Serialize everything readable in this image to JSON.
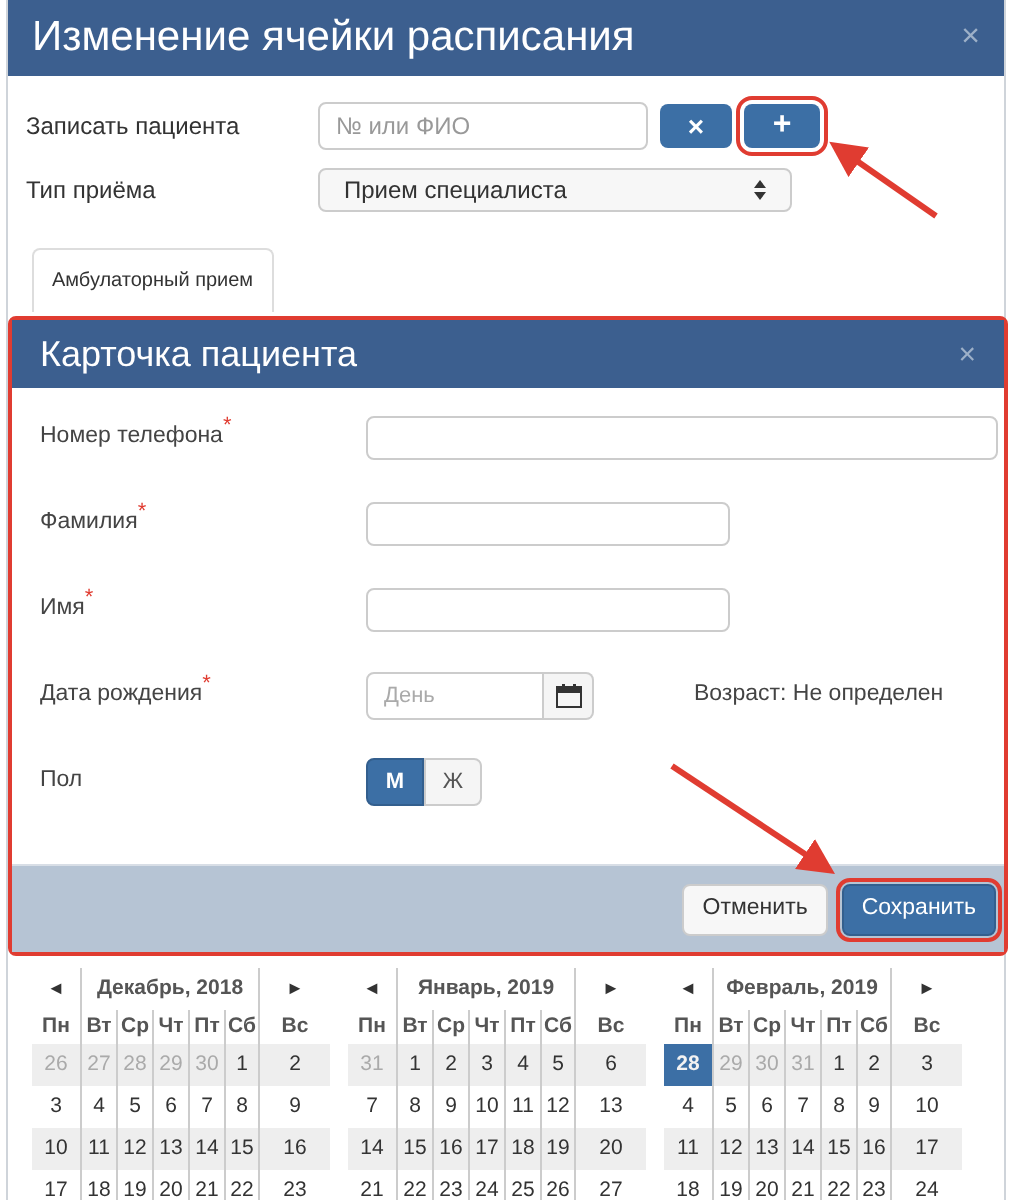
{
  "window": {
    "title": "Изменение ячейки расписания",
    "close": "×"
  },
  "form": [
    {
      "label": "Записать пациента",
      "kind": "search",
      "placeholder": "№ или ФИО",
      "clear": "×",
      "add": "+",
      "add_highlighted": true
    },
    {
      "label": "Тип приёма",
      "kind": "select",
      "value": "Прием специалиста"
    }
  ],
  "tabs": [
    {
      "label": "Амбулаторный прием",
      "selected": true
    }
  ],
  "patient_card": {
    "title": "Карточка пациента",
    "close": "×",
    "highlighted": true,
    "fields": [
      {
        "label": "Номер телефона",
        "required_mark": "*",
        "kind": "wide"
      },
      {
        "label": "Фамилия",
        "required_mark": "*",
        "kind": "text"
      },
      {
        "label": "Имя",
        "required_mark": "*",
        "kind": "text"
      },
      {
        "label": "Дата рождения",
        "required_mark": "*",
        "kind": "date",
        "placeholder": "День",
        "note": "Возраст: Не определен"
      },
      {
        "label": "Пол",
        "kind": "toggle",
        "options": [
          {
            "label": "М",
            "selected": true
          },
          {
            "label": "Ж",
            "selected": false
          }
        ]
      }
    ],
    "buttons": [
      {
        "label": "Отменить",
        "kind": "default",
        "highlighted": false
      },
      {
        "label": "Сохранить",
        "kind": "primary",
        "highlighted": true
      }
    ]
  },
  "calendars": [
    {
      "title": "Декабрь, 2018",
      "prev": "◄",
      "next": "►",
      "weekdays": [
        "Пн",
        "Вт",
        "Ср",
        "Чт",
        "Пт",
        "Сб",
        "Вс"
      ],
      "weeks": [
        [
          {
            "t": "26",
            "other": true,
            "selected": false
          },
          {
            "t": "27",
            "other": true,
            "selected": false
          },
          {
            "t": "28",
            "other": true,
            "selected": false
          },
          {
            "t": "29",
            "other": true,
            "selected": false
          },
          {
            "t": "30",
            "other": true,
            "selected": false
          },
          {
            "t": "1",
            "other": false,
            "selected": false
          },
          {
            "t": "2",
            "other": false,
            "selected": false
          }
        ],
        [
          {
            "t": "3",
            "other": false,
            "selected": false
          },
          {
            "t": "4",
            "other": false,
            "selected": false
          },
          {
            "t": "5",
            "other": false,
            "selected": false
          },
          {
            "t": "6",
            "other": false,
            "selected": false
          },
          {
            "t": "7",
            "other": false,
            "selected": false
          },
          {
            "t": "8",
            "other": false,
            "selected": false
          },
          {
            "t": "9",
            "other": false,
            "selected": false
          }
        ],
        [
          {
            "t": "10",
            "other": false,
            "selected": false
          },
          {
            "t": "11",
            "other": false,
            "selected": false
          },
          {
            "t": "12",
            "other": false,
            "selected": false
          },
          {
            "t": "13",
            "other": false,
            "selected": false
          },
          {
            "t": "14",
            "other": false,
            "selected": false
          },
          {
            "t": "15",
            "other": false,
            "selected": false
          },
          {
            "t": "16",
            "other": false,
            "selected": false
          }
        ],
        [
          {
            "t": "17",
            "other": false,
            "selected": false
          },
          {
            "t": "18",
            "other": false,
            "selected": false
          },
          {
            "t": "19",
            "other": false,
            "selected": false
          },
          {
            "t": "20",
            "other": false,
            "selected": false
          },
          {
            "t": "21",
            "other": false,
            "selected": false
          },
          {
            "t": "22",
            "other": false,
            "selected": false
          },
          {
            "t": "23",
            "other": false,
            "selected": false
          }
        ]
      ]
    },
    {
      "title": "Январь, 2019",
      "prev": "◄",
      "next": "►",
      "weekdays": [
        "Пн",
        "Вт",
        "Ср",
        "Чт",
        "Пт",
        "Сб",
        "Вс"
      ],
      "weeks": [
        [
          {
            "t": "31",
            "other": true,
            "selected": false
          },
          {
            "t": "1",
            "other": false,
            "selected": false
          },
          {
            "t": "2",
            "other": false,
            "selected": false
          },
          {
            "t": "3",
            "other": false,
            "selected": false
          },
          {
            "t": "4",
            "other": false,
            "selected": false
          },
          {
            "t": "5",
            "other": false,
            "selected": false
          },
          {
            "t": "6",
            "other": false,
            "selected": false
          }
        ],
        [
          {
            "t": "7",
            "other": false,
            "selected": false
          },
          {
            "t": "8",
            "other": false,
            "selected": false
          },
          {
            "t": "9",
            "other": false,
            "selected": false
          },
          {
            "t": "10",
            "other": false,
            "selected": false
          },
          {
            "t": "11",
            "other": false,
            "selected": false
          },
          {
            "t": "12",
            "other": false,
            "selected": false
          },
          {
            "t": "13",
            "other": false,
            "selected": false
          }
        ],
        [
          {
            "t": "14",
            "other": false,
            "selected": false
          },
          {
            "t": "15",
            "other": false,
            "selected": false
          },
          {
            "t": "16",
            "other": false,
            "selected": false
          },
          {
            "t": "17",
            "other": false,
            "selected": false
          },
          {
            "t": "18",
            "other": false,
            "selected": false
          },
          {
            "t": "19",
            "other": false,
            "selected": false
          },
          {
            "t": "20",
            "other": false,
            "selected": false
          }
        ],
        [
          {
            "t": "21",
            "other": false,
            "selected": false
          },
          {
            "t": "22",
            "other": false,
            "selected": false
          },
          {
            "t": "23",
            "other": false,
            "selected": false
          },
          {
            "t": "24",
            "other": false,
            "selected": false
          },
          {
            "t": "25",
            "other": false,
            "selected": false
          },
          {
            "t": "26",
            "other": false,
            "selected": false
          },
          {
            "t": "27",
            "other": false,
            "selected": false
          }
        ]
      ]
    },
    {
      "title": "Февраль, 2019",
      "prev": "◄",
      "next": "►",
      "weekdays": [
        "Пн",
        "Вт",
        "Ср",
        "Чт",
        "Пт",
        "Сб",
        "Вс"
      ],
      "weeks": [
        [
          {
            "t": "28",
            "other": true,
            "selected": true
          },
          {
            "t": "29",
            "other": true,
            "selected": false
          },
          {
            "t": "30",
            "other": true,
            "selected": false
          },
          {
            "t": "31",
            "other": true,
            "selected": false
          },
          {
            "t": "1",
            "other": false,
            "selected": false
          },
          {
            "t": "2",
            "other": false,
            "selected": false
          },
          {
            "t": "3",
            "other": false,
            "selected": false
          }
        ],
        [
          {
            "t": "4",
            "other": false,
            "selected": false
          },
          {
            "t": "5",
            "other": false,
            "selected": false
          },
          {
            "t": "6",
            "other": false,
            "selected": false
          },
          {
            "t": "7",
            "other": false,
            "selected": false
          },
          {
            "t": "8",
            "other": false,
            "selected": false
          },
          {
            "t": "9",
            "other": false,
            "selected": false
          },
          {
            "t": "10",
            "other": false,
            "selected": false
          }
        ],
        [
          {
            "t": "11",
            "other": false,
            "selected": false
          },
          {
            "t": "12",
            "other": false,
            "selected": false
          },
          {
            "t": "13",
            "other": false,
            "selected": false
          },
          {
            "t": "14",
            "other": false,
            "selected": false
          },
          {
            "t": "15",
            "other": false,
            "selected": false
          },
          {
            "t": "16",
            "other": false,
            "selected": false
          },
          {
            "t": "17",
            "other": false,
            "selected": false
          }
        ],
        [
          {
            "t": "18",
            "other": false,
            "selected": false
          },
          {
            "t": "19",
            "other": false,
            "selected": false
          },
          {
            "t": "20",
            "other": false,
            "selected": false
          },
          {
            "t": "21",
            "other": false,
            "selected": false
          },
          {
            "t": "22",
            "other": false,
            "selected": false
          },
          {
            "t": "23",
            "other": false,
            "selected": false
          },
          {
            "t": "24",
            "other": false,
            "selected": false
          }
        ]
      ]
    }
  ]
}
